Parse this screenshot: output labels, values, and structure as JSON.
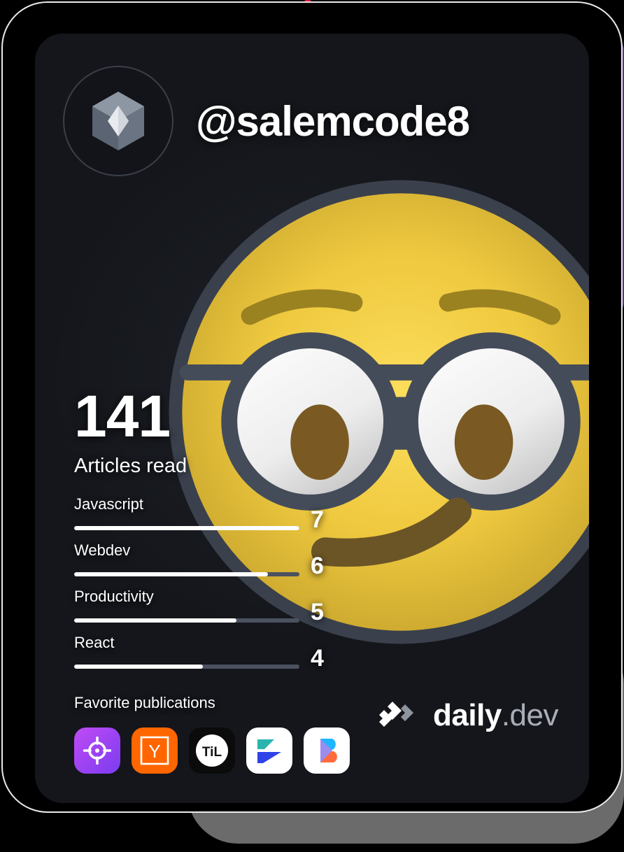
{
  "profile": {
    "username": "@salemcode8",
    "avatar_icon": "daily-dev-hexagon-avatar-icon"
  },
  "stats": {
    "articles_read_count": "141",
    "articles_read_label": "Articles read"
  },
  "tags": [
    {
      "name": "Javascript",
      "value": "7",
      "fill_percent": 100
    },
    {
      "name": "Webdev",
      "value": "6",
      "fill_percent": 86
    },
    {
      "name": "Productivity",
      "value": "5",
      "fill_percent": 72
    },
    {
      "name": "React",
      "value": "4",
      "fill_percent": 57
    }
  ],
  "publications": {
    "title": "Favorite publications",
    "items": [
      {
        "icon": "crosshair-target-icon",
        "bg": "#A545F0"
      },
      {
        "icon": "hacker-news-y-icon",
        "bg": "#FF6600"
      },
      {
        "icon": "til-circle-icon",
        "bg": "#0B0B0B"
      },
      {
        "icon": "play-arrow-banner-icon",
        "bg": "#FFFFFF"
      },
      {
        "icon": "b-letter-prism-icon",
        "bg": "#FFFFFF"
      }
    ]
  },
  "brand": {
    "name": "daily",
    "tld": ".dev",
    "logo_icon": "daily-dev-chevron-logo-icon"
  },
  "emoji": {
    "name": "nerd-face-emoji",
    "glyph": "🤓"
  },
  "colors": {
    "card_bg": "#16181D",
    "page_bg": "#000000",
    "accent_red": "#E8174A",
    "accent_purple": "#5D2E91",
    "accent_yellow": "#EDE016",
    "accent_gray": "#6B6B6B",
    "bar_filled": "#FFFFFF",
    "bar_track": "#4B515F",
    "text_primary": "#FFFFFF",
    "brand_tld": "#A8ADB7"
  }
}
